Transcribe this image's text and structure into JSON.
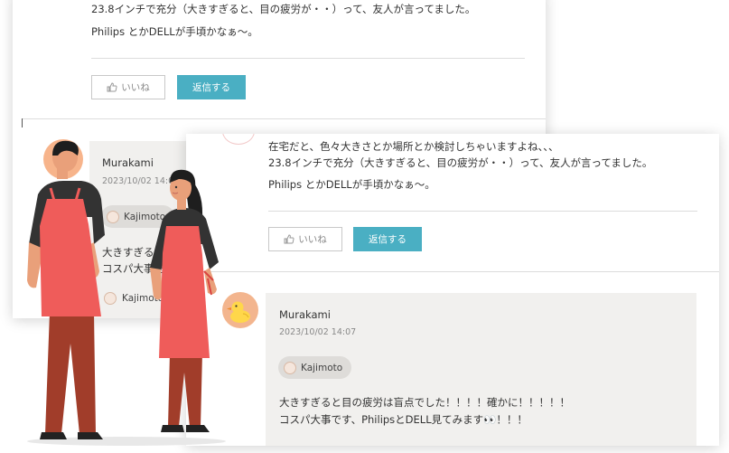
{
  "back_card": {
    "line2": "23.8インチで充分（大きすぎると、目の疲労が・・）って、友人が言ってました。",
    "line3": "Philips とかDELLが手頃かなぁ〜。",
    "like_label": "いいね",
    "reply_label": "返信する",
    "reply": {
      "name": "Murakami",
      "date": "2023/10/02 14:07",
      "tag": "Kajimoto",
      "text1": "大きすぎると",
      "text2": "コスパ大事で",
      "footer_tag": "Kajimoto"
    }
  },
  "front_card": {
    "line1": "在宅だと、色々大きさとか場所とか検討しちゃいますよね、、、",
    "line2": "23.8インチで充分（大きすぎると、目の疲労が・・）って、友人が言ってました。",
    "line3": "Philips とかDELLが手頃かなぁ〜。",
    "like_label": "いいね",
    "reply_label": "返信する",
    "reply": {
      "name": "Murakami",
      "date": "2023/10/02 14:07",
      "tag": "Kajimoto",
      "text1": "大きすぎると目の疲労は盲点でした！！！！確かに！！！！！",
      "text2": "コスパ大事です、PhilipsとDELL見てみます👀！！！"
    }
  },
  "colors": {
    "reply_button": "#4aafc3",
    "reply_box": "#f1f0ee",
    "apron": "#ef5c5a",
    "avatar_duck_bg": "#f3b58e"
  },
  "icons": {
    "like": "thumbs-up-icon",
    "avatar": "duck-avatar-icon"
  }
}
